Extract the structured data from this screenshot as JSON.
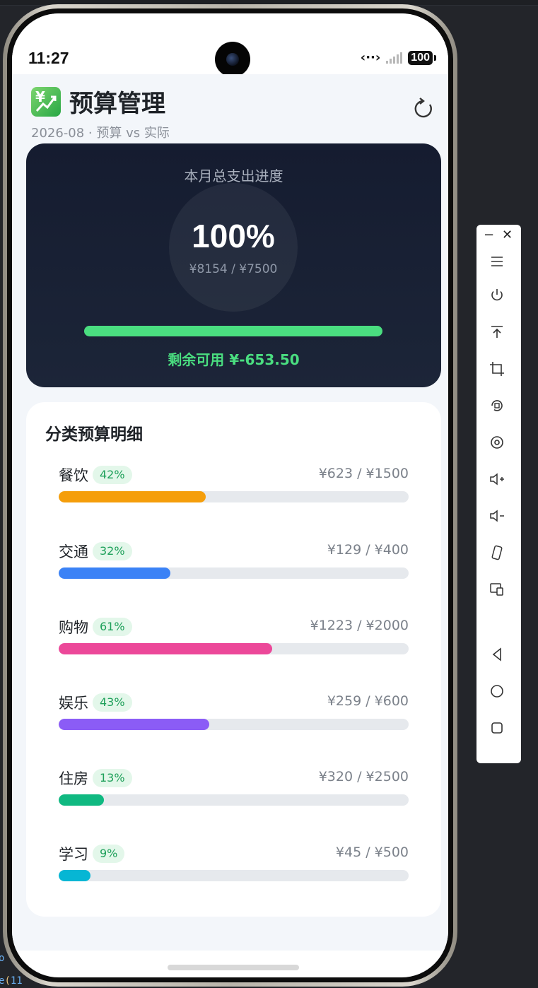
{
  "status": {
    "time": "11:27",
    "battery": "100"
  },
  "header": {
    "title": "预算管理",
    "subtitle": "2026-08 · 预算 vs 实际"
  },
  "summary": {
    "label": "本月总支出进度",
    "percent_text": "100%",
    "amount_text": "¥8154 / ¥7500",
    "progress": 1.0,
    "remaining_text": "剩余可用 ¥-653.50"
  },
  "details": {
    "title": "分类预算明细",
    "categories": [
      {
        "name": "餐饮",
        "badge": "42%",
        "amount": "¥623 / ¥1500",
        "progress": 0.42,
        "color": "#f59e0b"
      },
      {
        "name": "交通",
        "badge": "32%",
        "amount": "¥129 / ¥400",
        "progress": 0.32,
        "color": "#3b82f6"
      },
      {
        "name": "购物",
        "badge": "61%",
        "amount": "¥1223 / ¥2000",
        "progress": 0.61,
        "color": "#ec4899"
      },
      {
        "name": "娱乐",
        "badge": "43%",
        "amount": "¥259 / ¥600",
        "progress": 0.43,
        "color": "#8b5cf6"
      },
      {
        "name": "住房",
        "badge": "13%",
        "amount": "¥320 / ¥2500",
        "progress": 0.13,
        "color": "#10b981"
      },
      {
        "name": "学习",
        "badge": "9%",
        "amount": "¥45 / ¥500",
        "progress": 0.09,
        "color": "#06b6d4"
      }
    ]
  },
  "colors": {
    "accent": "#4ade80",
    "badge_bg": "#e3f7ea",
    "badge_text": "#1ea05a",
    "card_dark": "#151c30"
  },
  "toolbar": {
    "icons": [
      "menu-icon",
      "power-icon",
      "pin-top-icon",
      "crop-icon",
      "rotate-icon",
      "screen-record-icon",
      "volume-up-icon",
      "volume-down-icon",
      "rotate-device-icon",
      "multi-screen-icon",
      "back-icon",
      "home-icon",
      "recents-icon"
    ]
  }
}
